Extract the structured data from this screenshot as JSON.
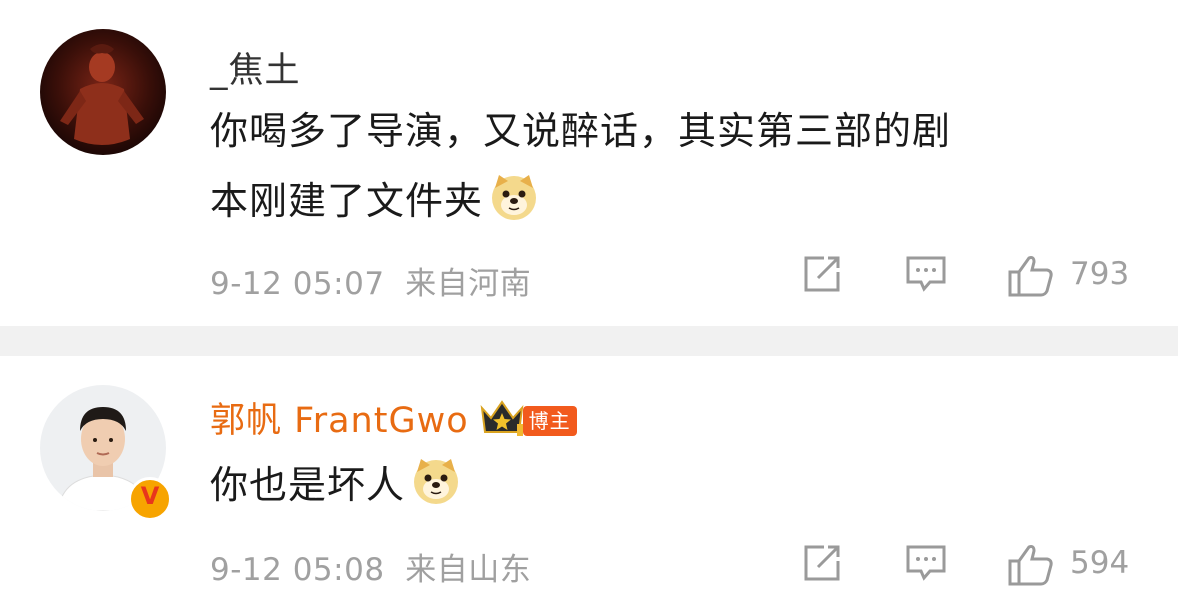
{
  "comments": [
    {
      "username": "_焦土",
      "text_line1": "你喝多了导演，又说醉话，其实第三部的剧",
      "text_line2": "本刚建了文件夹",
      "emoji": "doge-emoji",
      "time": "9-12 05:07",
      "location": "来自河南",
      "likes": "793"
    },
    {
      "username": "郭帆 FrantGwo",
      "badge": "博主",
      "text": "你也是坏人",
      "emoji": "doge-emoji",
      "time": "9-12 05:08",
      "location": "来自山东",
      "likes": "594",
      "verified_mark": "V"
    }
  ],
  "colors": {
    "username_default": "#333333",
    "username_author": "#e86b12",
    "meta_gray": "#a0a0a0",
    "divider": "#f1f1f1",
    "badge": "#f25a1d"
  },
  "icons": [
    "share-icon",
    "comment-icon",
    "like-icon",
    "crown-icon",
    "verified-icon",
    "doge-emoji"
  ]
}
